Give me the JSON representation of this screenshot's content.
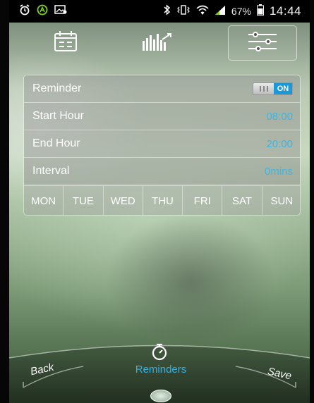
{
  "status_bar": {
    "icons": [
      "alarm-clock-icon",
      "android-a-icon",
      "image-notification-icon",
      "bluetooth-icon",
      "vibrate-icon",
      "wifi-icon",
      "signal-icon",
      "battery-icon"
    ],
    "battery": "67%",
    "time": "14:44"
  },
  "toolbar": {
    "buttons": [
      "calendar-icon",
      "stats-chart-icon",
      "sliders-icon"
    ],
    "active": "sliders-icon"
  },
  "settings": {
    "reminder_label": "Reminder",
    "reminder_toggle": "ON",
    "start_label": "Start Hour",
    "start_value": "08:00",
    "end_label": "End Hour",
    "end_value": "20:00",
    "interval_label": "Interval",
    "interval_value": "0mins"
  },
  "days": [
    "MON",
    "TUE",
    "WED",
    "THU",
    "FRI",
    "SAT",
    "SUN"
  ],
  "bottom_nav": {
    "back": "Back",
    "title": "Reminders",
    "save": "Save",
    "center_icon": "stopwatch-icon"
  },
  "colors": {
    "accent": "#3bb6e6",
    "toggle_on": "#1b98d6",
    "status_bar": "#000000"
  }
}
